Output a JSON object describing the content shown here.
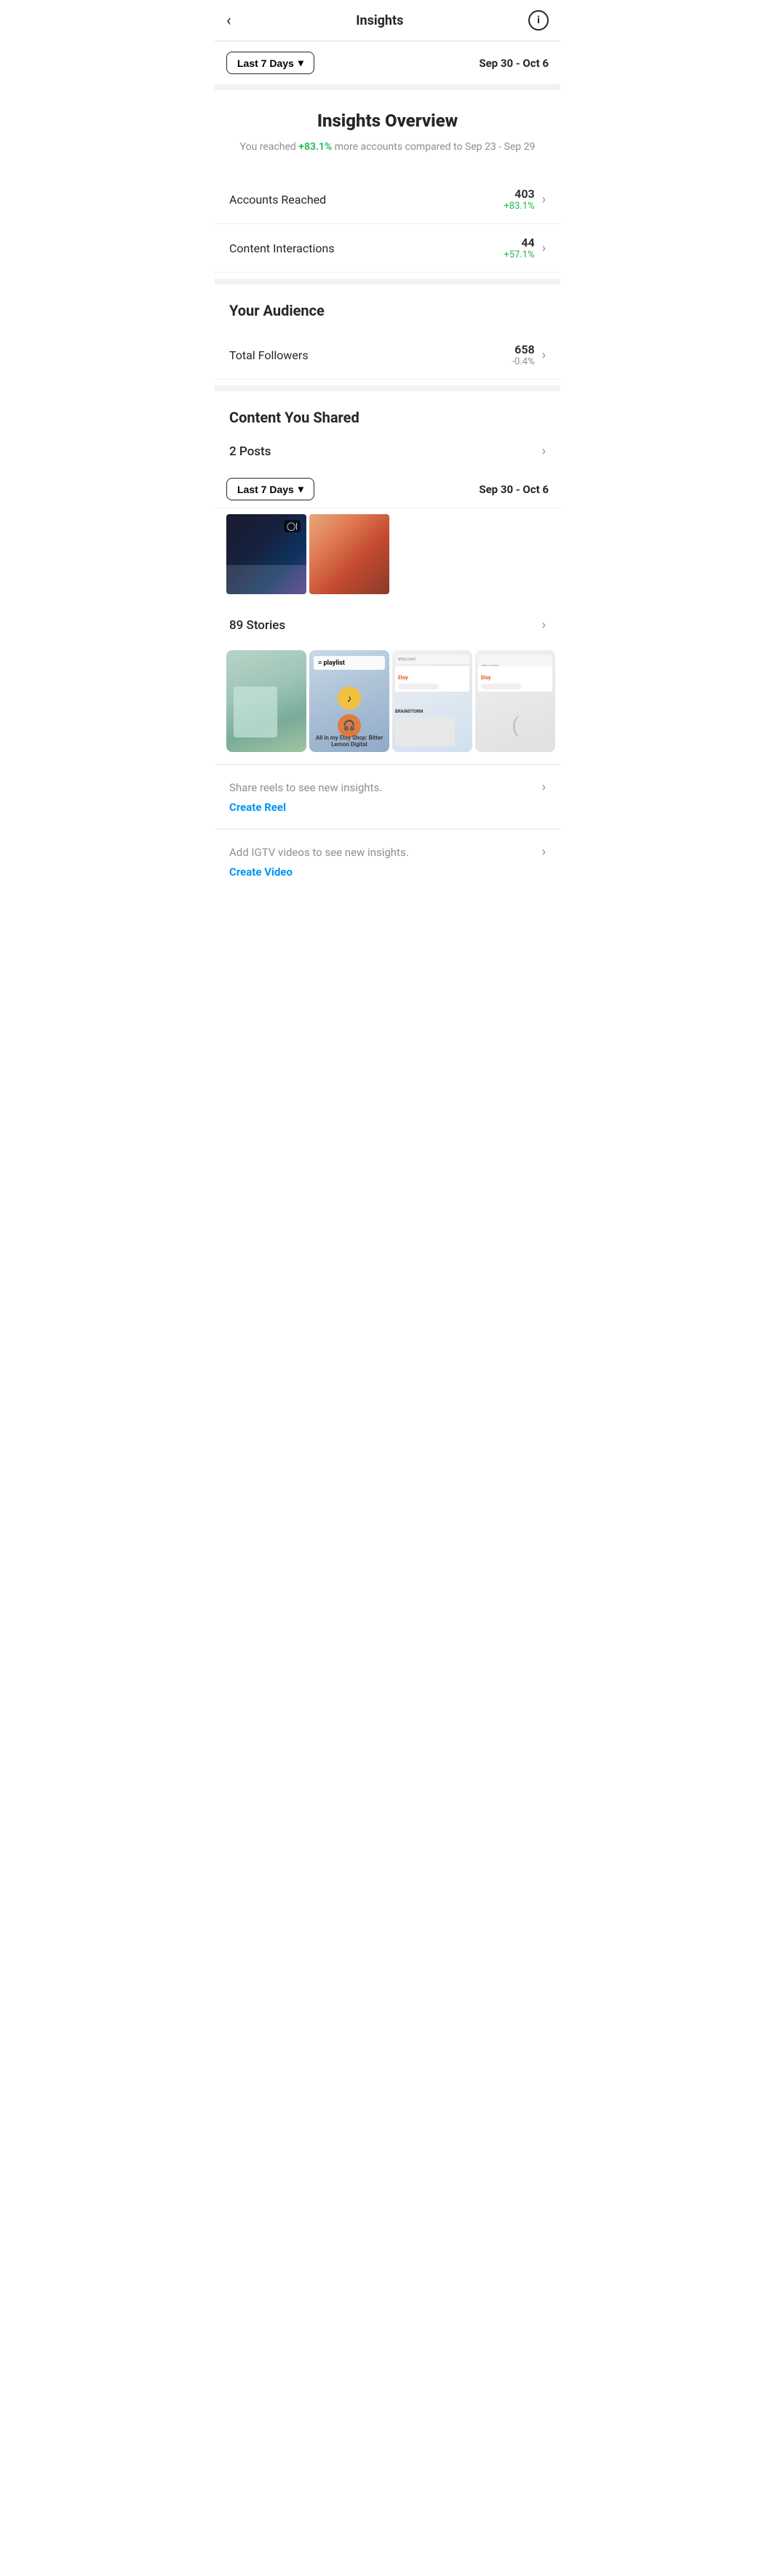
{
  "header": {
    "title": "Insights",
    "back_label": "‹",
    "info_label": "i"
  },
  "date_filter": {
    "button_label": "Last 7 Days",
    "chevron": "▾",
    "date_range": "Sep 30 - Oct 6"
  },
  "overview": {
    "title": "Insights Overview",
    "subtitle_before": "You reached ",
    "highlight": "+83.1%",
    "subtitle_after": " more accounts compared to Sep 23 - Sep 29"
  },
  "stats": [
    {
      "label": "Accounts Reached",
      "value": "403",
      "change": "+83.1%",
      "change_type": "positive"
    },
    {
      "label": "Content Interactions",
      "value": "44",
      "change": "+57.1%",
      "change_type": "positive"
    }
  ],
  "audience": {
    "section_title": "Your Audience",
    "stats": [
      {
        "label": "Total Followers",
        "value": "658",
        "change": "-0.4%",
        "change_type": "negative"
      }
    ]
  },
  "content": {
    "section_title": "Content You Shared",
    "posts_label": "2 Posts",
    "stories_label": "89 Stories",
    "date_filter_button": "Last 7 Days",
    "date_filter_chevron": "▾",
    "date_range": "Sep 30 - Oct 6"
  },
  "promos": [
    {
      "text": "Share reels to see new insights.",
      "link_label": "Create Reel"
    },
    {
      "text": "Add IGTV videos to see new insights.",
      "link_label": "Create Video"
    }
  ],
  "colors": {
    "positive": "#1db954",
    "negative": "#8e8e8e",
    "link": "#0095f6",
    "border": "#e0e0e0",
    "bg_alt": "#f2f2f2",
    "text_primary": "#262626",
    "text_secondary": "#8e8e8e"
  }
}
